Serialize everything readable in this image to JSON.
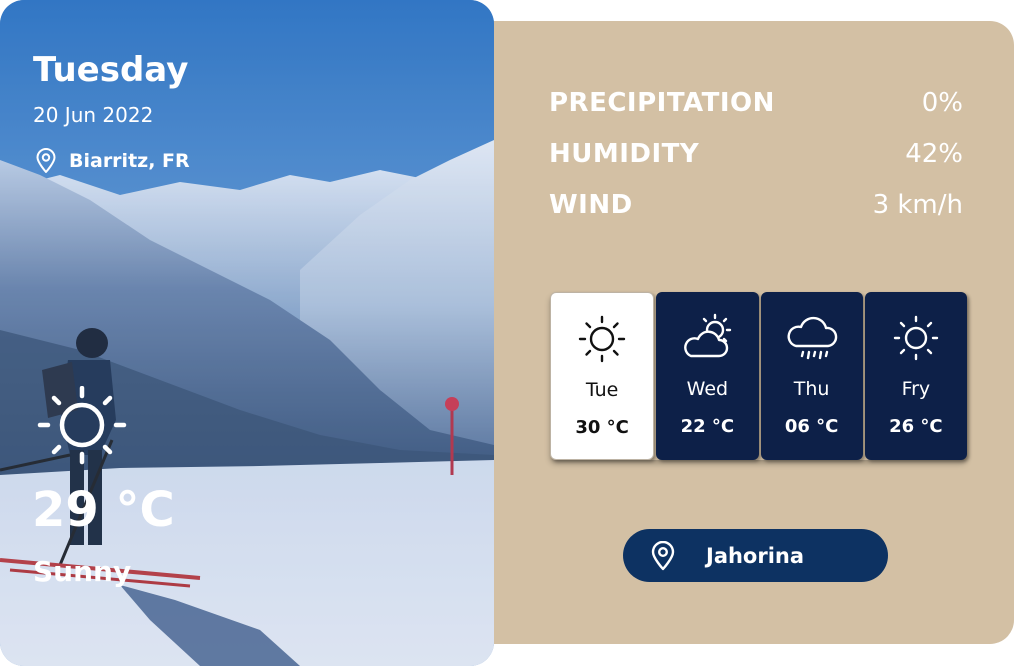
{
  "current": {
    "day": "Tuesday",
    "date": "20 Jun 2022",
    "location": "Biarritz, FR",
    "temperature": "29 °C",
    "condition": "Sunny",
    "icon": "sun-icon"
  },
  "stats": [
    {
      "label": "PRECIPITATION",
      "value": "0%"
    },
    {
      "label": "HUMIDITY",
      "value": "42%"
    },
    {
      "label": "WIND",
      "value": "3 km/h"
    }
  ],
  "forecast": [
    {
      "day": "Tue",
      "temp": "30 °C",
      "icon": "sun-icon",
      "active": true
    },
    {
      "day": "Wed",
      "temp": "22 °C",
      "icon": "partly-cloudy-icon",
      "active": false
    },
    {
      "day": "Thu",
      "temp": "06 °C",
      "icon": "rain-cloud-icon",
      "active": false
    },
    {
      "day": "Fry",
      "temp": "26 °C",
      "icon": "sun-icon",
      "active": false
    }
  ],
  "location_button": {
    "label": "Jahorina",
    "icon": "location-pin-icon"
  },
  "colors": {
    "panel_background": "#d3c0a4",
    "forecast_card": "#0d2048",
    "forecast_card_active": "#ffffff",
    "button_background": "#0d3262",
    "text_light": "#ffffff"
  }
}
